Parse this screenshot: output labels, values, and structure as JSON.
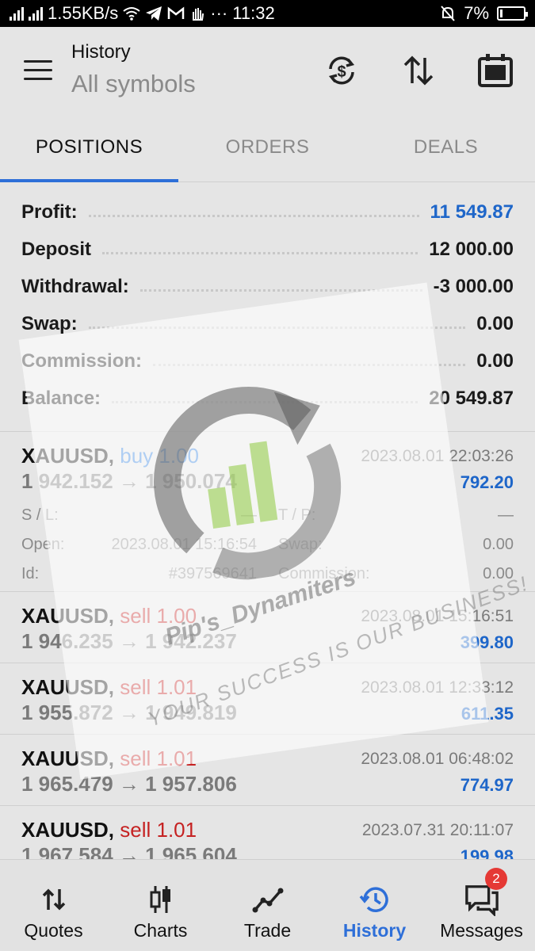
{
  "statusbar": {
    "network_speed": "1.55KB/s",
    "icons": [
      "signal-icon",
      "signal-icon",
      "wifi-icon",
      "telegram-icon",
      "gmail-icon",
      "hand-icon",
      "more-icon"
    ],
    "time": "11:32",
    "battery": "7%"
  },
  "appbar": {
    "title": "History",
    "subtitle": "All symbols",
    "actions": [
      "currency-exchange-icon",
      "sort-icon",
      "calendar-icon"
    ]
  },
  "tabs": [
    {
      "label": "POSITIONS",
      "active": true
    },
    {
      "label": "ORDERS",
      "active": false
    },
    {
      "label": "DEALS",
      "active": false
    }
  ],
  "summary": [
    {
      "label": "Profit:",
      "value": "11 549.87",
      "accent": "#1e66c9"
    },
    {
      "label": "Deposit",
      "value": "12 000.00"
    },
    {
      "label": "Withdrawal:",
      "value": "-3 000.00"
    },
    {
      "label": "Swap:",
      "value": "0.00"
    },
    {
      "label": "Commission:",
      "value": "0.00"
    },
    {
      "label": "Balance:",
      "value": "20 549.87"
    }
  ],
  "trades": [
    {
      "symbol": "XAUUSD,",
      "direction": "buy 1.00",
      "type": "buy",
      "time": "2023.08.01 22:03:26",
      "prices": "1 942.152 → 1 950.074",
      "profit": "792.20",
      "details": {
        "sl_label": "S / L:",
        "sl_value": "—",
        "tp_label": "T / P:",
        "tp_value": "—",
        "open_label": "Open:",
        "open_value": "2023.08.01 15:16:54",
        "swap_label": "Swap:",
        "swap_value": "0.00",
        "id_label": "Id:",
        "id_value": "#397569641",
        "commission_label": "Commission:",
        "commission_value": "0.00"
      }
    },
    {
      "symbol": "XAUUSD,",
      "direction": "sell 1.00",
      "type": "sell",
      "time": "2023.08.01 15:16:51",
      "prices": "1 946.235 → 1 942.237",
      "profit": "399.80"
    },
    {
      "symbol": "XAUUSD,",
      "direction": "sell 1.01",
      "type": "sell",
      "time": "2023.08.01 12:33:12",
      "prices": "1 955.872 → 1 949.819",
      "profit": "611.35"
    },
    {
      "symbol": "XAUUSD,",
      "direction": "sell 1.01",
      "type": "sell",
      "time": "2023.08.01 06:48:02",
      "prices": "1 965.479 → 1 957.806",
      "profit": "774.97"
    },
    {
      "symbol": "XAUUSD,",
      "direction": "sell 1.01",
      "type": "sell",
      "time": "2023.07.31 20:11:07",
      "prices": "1 967.584 → 1 965.604",
      "profit": "199.98"
    }
  ],
  "watermark": {
    "line1": "Pip's_Dynamiters",
    "line2": "YOUR SUCCESS IS OUR BUSINESS!"
  },
  "bottomnav": [
    {
      "label": "Quotes",
      "icon": "quotes-arrows-icon",
      "active": false
    },
    {
      "label": "Charts",
      "icon": "candlestick-icon",
      "active": false
    },
    {
      "label": "Trade",
      "icon": "trade-line-icon",
      "active": false
    },
    {
      "label": "History",
      "icon": "history-icon",
      "active": true
    },
    {
      "label": "Messages",
      "icon": "chat-icon",
      "active": false,
      "badge": "2"
    }
  ],
  "colors": {
    "accent": "#2e6fd8",
    "profit_blue": "#1e66c9",
    "buy_blue": "#2e7fe0",
    "sell_red": "#c52222",
    "badge_red": "#e53935"
  }
}
